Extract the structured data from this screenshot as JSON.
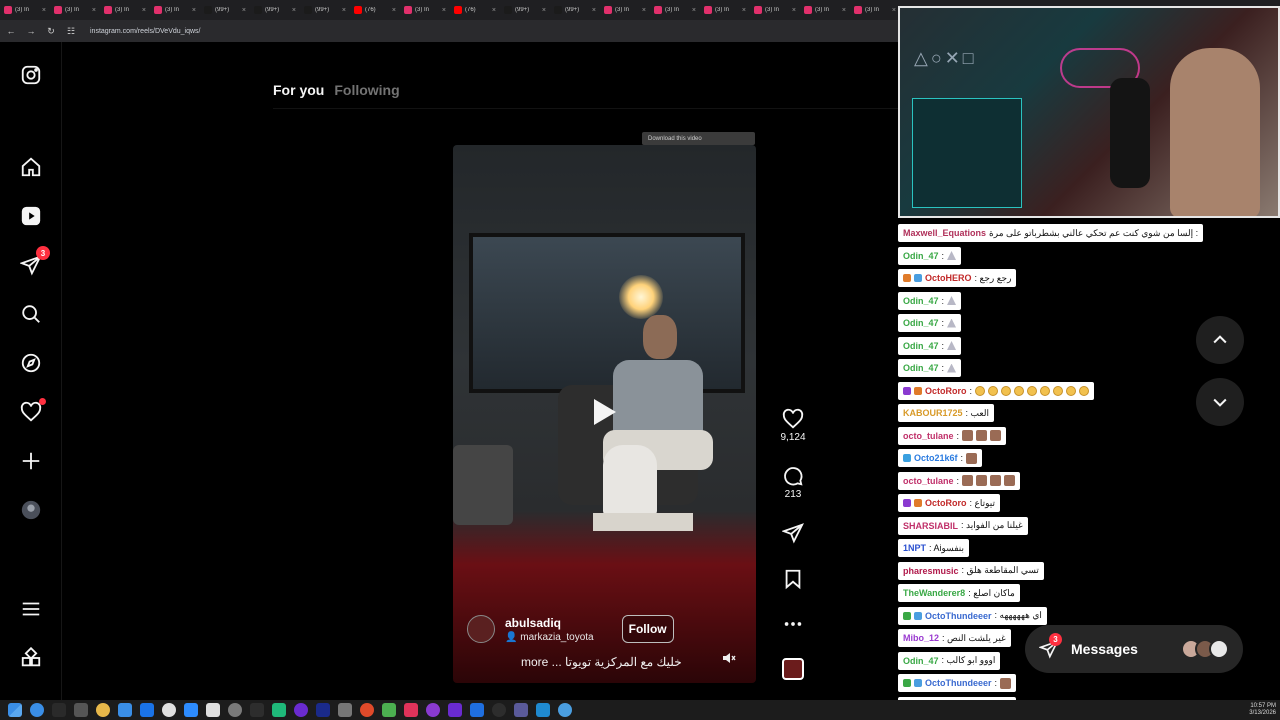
{
  "browser": {
    "tabs": [
      {
        "label": "(3) In",
        "color": "#e1306c"
      },
      {
        "label": "(3) In",
        "color": "#e1306c"
      },
      {
        "label": "(3) In",
        "color": "#e1306c"
      },
      {
        "label": "(3) In",
        "color": "#e1306c"
      },
      {
        "label": "(99+)",
        "color": "#1b1b1b"
      },
      {
        "label": "(99+)",
        "color": "#1b1b1b"
      },
      {
        "label": "(99+)",
        "color": "#1b1b1b"
      },
      {
        "label": "(76)",
        "color": "#ff0000"
      },
      {
        "label": "(3) In",
        "color": "#e1306c"
      },
      {
        "label": "(76)",
        "color": "#ff0000"
      },
      {
        "label": "(99+)",
        "color": "#1b1b1b"
      },
      {
        "label": "(99+)",
        "color": "#1b1b1b"
      },
      {
        "label": "(3) In",
        "color": "#e1306c"
      },
      {
        "label": "(3) In",
        "color": "#e1306c"
      },
      {
        "label": "(3) In",
        "color": "#e1306c"
      },
      {
        "label": "(3) In",
        "color": "#e1306c"
      },
      {
        "label": "(3) In",
        "color": "#e1306c"
      },
      {
        "label": "(3) In",
        "color": "#e1306c"
      }
    ],
    "url": "instagram.com/reels/DVeVdu_iqws/"
  },
  "nav": {
    "notifications_badge": "3"
  },
  "feed_tabs": {
    "for_you": "For you",
    "following": "Following"
  },
  "download_bar": "Download this video",
  "reel": {
    "username": "abulsadiq",
    "collab": "markazia_toyota",
    "follow_label": "Follow",
    "caption": "خليك مع المركزية تويوتا ... more",
    "likes": "9,124",
    "comments": "213"
  },
  "chat": [
    {
      "user": "Maxwell_Equations",
      "color": "#b0305a",
      "text": "إلسا من شوي كنت عم تحكي عالني بشطرباتو على مرة :",
      "emotes": []
    },
    {
      "user": "Odin_47",
      "color": "#39a845",
      "text": ":",
      "emotes": [
        "rocket"
      ]
    },
    {
      "user": "OctoHERO",
      "color": "#c22a2a",
      "text": ": رجع رجع",
      "emotes": [],
      "badges": [
        "#e07b2a",
        "#4a9ee0"
      ]
    },
    {
      "user": "Odin_47",
      "color": "#39a845",
      "text": ":",
      "emotes": [
        "rocket"
      ]
    },
    {
      "user": "Odin_47",
      "color": "#39a845",
      "text": ":",
      "emotes": [
        "rocket"
      ]
    },
    {
      "user": "Odin_47",
      "color": "#39a845",
      "text": ":",
      "emotes": [
        "rocket"
      ]
    },
    {
      "user": "Odin_47",
      "color": "#39a845",
      "text": ":",
      "emotes": [
        "rocket"
      ]
    },
    {
      "user": "OctoRoro",
      "color": "#c22a2a",
      "text": ":",
      "emotes": [
        "smile",
        "smile",
        "smile",
        "smile",
        "smile",
        "smile",
        "smile",
        "smile",
        "smile"
      ],
      "badges": [
        "#8a3ad0",
        "#e07b2a"
      ]
    },
    {
      "user": "KABOUR1725",
      "color": "#d89a28",
      "text": ": العب",
      "emotes": []
    },
    {
      "user": "octo_tulane",
      "color": "#c0306a",
      "text": ":",
      "emotes": [
        "face",
        "face",
        "face"
      ]
    },
    {
      "user": "Octo21k6f",
      "color": "#2a7be0",
      "text": ":",
      "emotes": [
        "face"
      ],
      "badges": [
        "#3aa0e0"
      ]
    },
    {
      "user": "octo_tulane",
      "color": "#c0306a",
      "text": ":",
      "emotes": [
        "face",
        "face",
        "face",
        "face"
      ]
    },
    {
      "user": "OctoRoro",
      "color": "#c22a2a",
      "text": ": تيوتاع",
      "emotes": [],
      "badges": [
        "#8a3ad0",
        "#e07b2a"
      ]
    },
    {
      "user": "SHARSIABIL",
      "color": "#c0306a",
      "text": ": غيلنا من الفوايد",
      "emotes": []
    },
    {
      "user": "1NPT",
      "color": "#2a50d0",
      "text": ": Aiبنفسو",
      "emotes": []
    },
    {
      "user": "pharesmusic",
      "color": "#b0184a",
      "text": ": تسي المقاطعة هلق",
      "emotes": []
    },
    {
      "user": "TheWanderer8",
      "color": "#39a845",
      "text": ": ماكان اصلع",
      "emotes": []
    },
    {
      "user": "OctoThundeeer",
      "color": "#3a6ad0",
      "text": ": اي ههههههه",
      "emotes": [],
      "badges": [
        "#3aa845",
        "#4a9ee0"
      ]
    },
    {
      "user": "Mibo_12",
      "color": "#9a3ad0",
      "text": ": غير يلشت النص",
      "emotes": []
    },
    {
      "user": "Odin_47",
      "color": "#39a845",
      "text": ": اووو ابو كالب",
      "emotes": []
    },
    {
      "user": "OctoThundeeer",
      "color": "#3a6ad0",
      "text": ":",
      "emotes": [
        "face"
      ],
      "badges": [
        "#3aa845",
        "#4a9ee0"
      ]
    },
    {
      "user": "OctoThundeeer",
      "color": "#3a6ad0",
      "text": ":",
      "emotes": [
        "face"
      ],
      "badges": [
        "#3aa845",
        "#4a9ee0"
      ]
    }
  ],
  "messages": {
    "label": "Messages",
    "badge": "3"
  },
  "taskbar": {
    "icons": [
      "#3a8ee6",
      "#2a2a2a",
      "#555",
      "#e8b84a",
      "#3a8ee6",
      "#1a73e8",
      "#e0e0e0",
      "#2d8cff",
      "#e0e0e0",
      "#7a7a7a",
      "#2d2d2d",
      "#1fb97a",
      "#6a2bd0",
      "#1a2a8a",
      "#777",
      "#e04a2a",
      "#4caf50",
      "#e0335a",
      "#8a3ad0",
      "#6a2bd0",
      "#1f6fe0",
      "#2d2d2d",
      "#5a5a9a",
      "#1f8ad0",
      "#4a9ee0"
    ],
    "time": "10:57 PM",
    "date": "3/13/2026"
  }
}
